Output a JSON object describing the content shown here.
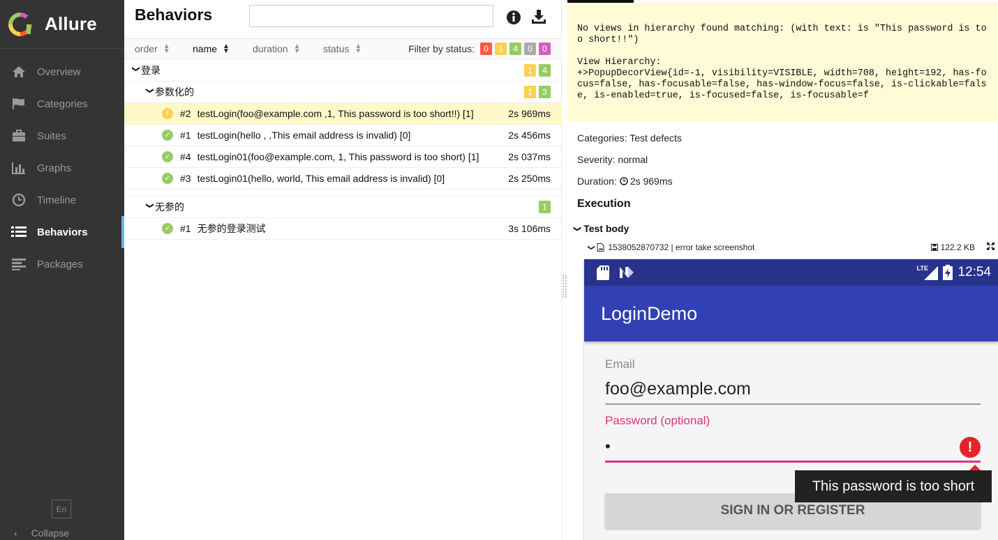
{
  "app": {
    "name": "Allure"
  },
  "sidebar": {
    "items": [
      {
        "label": "Overview",
        "icon": "home-icon"
      },
      {
        "label": "Categories",
        "icon": "flag-icon"
      },
      {
        "label": "Suites",
        "icon": "briefcase-icon"
      },
      {
        "label": "Graphs",
        "icon": "bar-chart-icon"
      },
      {
        "label": "Timeline",
        "icon": "clock-icon"
      },
      {
        "label": "Behaviors",
        "icon": "list-icon",
        "active": true
      },
      {
        "label": "Packages",
        "icon": "align-left-icon"
      }
    ],
    "language": "En",
    "collapse_label": "Collapse"
  },
  "behaviors": {
    "title": "Behaviors",
    "search_placeholder": "",
    "sort": {
      "order": "order",
      "name": "name",
      "duration": "duration",
      "status": "status"
    },
    "filter_label": "Filter by status:",
    "filter_counts": {
      "failed": "0",
      "broken": "1",
      "passed": "4",
      "skipped": "0",
      "unknown": "0"
    },
    "groups": [
      {
        "name": "登录",
        "broken": "1",
        "passed": "4"
      },
      {
        "name": "参数化的",
        "broken": "1",
        "passed": "3",
        "tests": [
          {
            "num": "#2",
            "name": "testLogin(foo@example.com ,1, This password is too short!!) [1]",
            "duration": "2s 969ms",
            "status": "broken",
            "selected": true
          },
          {
            "num": "#1",
            "name": "testLogin(hello , ,This email address is invalid) [0]",
            "duration": "2s 456ms",
            "status": "passed"
          },
          {
            "num": "#4",
            "name": "testLogin01(foo@example.com, 1, This password is too short) [1]",
            "duration": "2s 037ms",
            "status": "passed"
          },
          {
            "num": "#3",
            "name": "testLogin01(hello, world, This email address is invalid) [0]",
            "duration": "2s 250ms",
            "status": "passed"
          }
        ]
      },
      {
        "name": "无参的",
        "passed": "1",
        "tests": [
          {
            "num": "#1",
            "name": "无参的登录测试",
            "duration": "3s 106ms",
            "status": "passed"
          }
        ]
      }
    ]
  },
  "detail": {
    "message": "No views in hierarchy found matching: (with text: is \"This password is too short!!\")\n\nView Hierarchy:\n+>PopupDecorView{id=-1, visibility=VISIBLE, width=708, height=192, has-focus=false, has-focusable=false, has-window-focus=false, is-clickable=false, is-enabled=true, is-focused=false, is-focusable=f",
    "categories": "Categories: Test defects",
    "severity": "Severity: normal",
    "duration_label": "Duration:",
    "duration": "2s 969ms",
    "execution_title": "Execution",
    "step_title": "Test body",
    "attachment": {
      "name": "1538052870732 | error take screenshot",
      "size": "122.2 KB"
    }
  },
  "screenshot": {
    "time": "12:54",
    "network": "LTE",
    "app_title": "LoginDemo",
    "email_label": "Email",
    "email_value": "foo@example.com",
    "password_label": "Password (optional)",
    "password_value": "•",
    "error_tooltip": "This password is too short",
    "button_label": "SIGN IN OR REGISTER"
  },
  "colors": {
    "sidebar_bg": "#343434",
    "active_indicator": "#6eb3e8",
    "failed": "#fd5a3e",
    "broken": "#ffd050",
    "passed": "#97cc64",
    "skipped": "#aaaaaa",
    "unknown": "#d35ebe",
    "selected_row": "#fff8c8",
    "message_bg": "#fffbd7",
    "android_primary": "#3141b3",
    "android_accent": "#e0317d"
  }
}
